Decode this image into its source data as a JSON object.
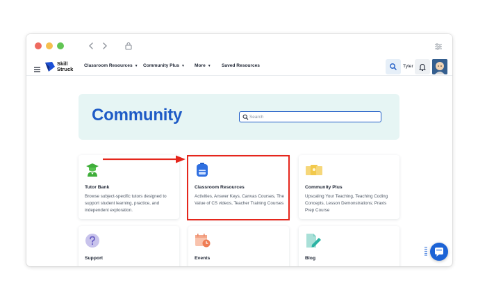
{
  "browser": {
    "controls": [
      "close",
      "minimize",
      "maximize"
    ],
    "back_icon": "chevron-left-icon",
    "forward_icon": "chevron-right-icon",
    "lock_icon": "lock-icon",
    "settings_icon": "sliders-icon"
  },
  "header": {
    "logo_text": "Skill\nStruck",
    "menu": [
      {
        "label": "Classroom Resources",
        "has_dropdown": true
      },
      {
        "label": "Community Plus",
        "has_dropdown": true
      },
      {
        "label": "More",
        "has_dropdown": true
      },
      {
        "label": "Saved Resources",
        "has_dropdown": false
      }
    ],
    "user_name": "Tyler"
  },
  "banner": {
    "title": "Community",
    "search_placeholder": "Search",
    "search_value": ""
  },
  "cards": [
    {
      "title": "Tutor Bank",
      "description": "Browse subject-specific tutors designed to support student learning, practice, and independent exploration.",
      "icon": "graduate-icon"
    },
    {
      "title": "Classroom Resources",
      "description": "Activities, Answer Keys, Canvas Courses, The Value of CS videos, Teacher Training Courses",
      "icon": "backpack-icon",
      "highlighted": true
    },
    {
      "title": "Community Plus",
      "description": "Upscaling Your Teaching, Teaching Coding Concepts, Lesson Demonstrations; Praxis Prep Course",
      "icon": "cards-icon"
    },
    {
      "title": "Support",
      "description": "",
      "icon": "question-icon"
    },
    {
      "title": "Events",
      "description": "",
      "icon": "calendar-icon"
    },
    {
      "title": "Blog",
      "description": "",
      "icon": "edit-document-icon"
    }
  ],
  "colors": {
    "accent": "#1e5bc6",
    "banner_bg": "#e6f5f4",
    "highlight": "#e5261c",
    "chat_button": "#1c63d6"
  }
}
